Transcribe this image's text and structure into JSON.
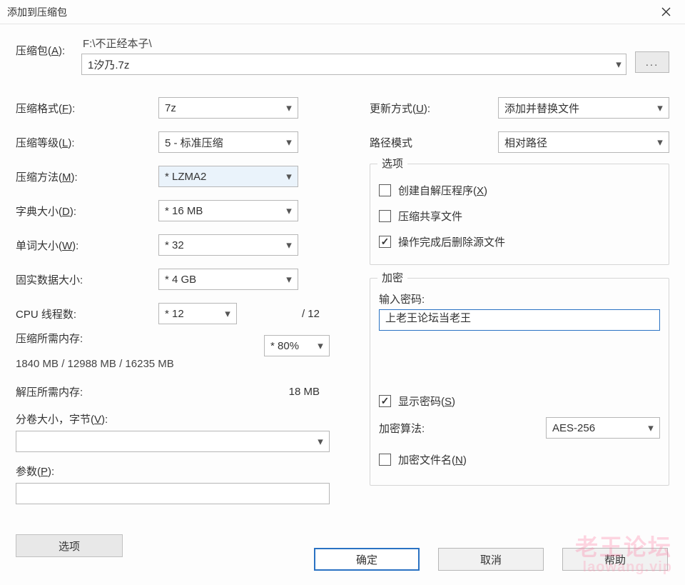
{
  "window": {
    "title": "添加到压缩包"
  },
  "archive": {
    "label_pre": "压缩包(",
    "label_key": "A",
    "label_post": "):",
    "path_text": "F:\\不正经本子\\",
    "filename": "1汐乃.7z"
  },
  "left": {
    "format": {
      "label_pre": "压缩格式(",
      "label_key": "F",
      "label_post": "):",
      "value": "7z"
    },
    "level": {
      "label_pre": "压缩等级(",
      "label_key": "L",
      "label_post": "):",
      "value": "5 - 标准压缩"
    },
    "method": {
      "label_pre": "压缩方法(",
      "label_key": "M",
      "label_post": "):",
      "value": "* LZMA2"
    },
    "dict": {
      "label_pre": "字典大小(",
      "label_key": "D",
      "label_post": "):",
      "value": "* 16 MB"
    },
    "word": {
      "label_pre": "单词大小(",
      "label_key": "W",
      "label_post": "):",
      "value": "* 32"
    },
    "solid": {
      "label": "固实数据大小:",
      "value": "* 4 GB"
    },
    "threads": {
      "label": "CPU 线程数:",
      "value": "* 12",
      "total": "/ 12"
    },
    "mem_comp": {
      "label": "压缩所需内存:",
      "detail": "1840 MB / 12988 MB / 16235 MB",
      "percent": "* 80%"
    },
    "mem_decomp": {
      "label": "解压所需内存:",
      "value": "18 MB"
    },
    "split": {
      "label_pre": "分卷大小，字节(",
      "label_key": "V",
      "label_post": "):"
    },
    "params": {
      "label_pre": "参数(",
      "label_key": "P",
      "label_post": "):"
    },
    "options_btn": "选项"
  },
  "right": {
    "update_mode": {
      "label_pre": "更新方式(",
      "label_key": "U",
      "label_post": "):",
      "value": "添加并替换文件"
    },
    "path_mode": {
      "label": "路径模式",
      "value": "相对路径"
    },
    "options_legend": "选项",
    "opt_sfx": {
      "label_pre": "创建自解压程序(",
      "label_key": "X",
      "label_post": ")",
      "checked": false
    },
    "opt_share": {
      "label": "压缩共享文件",
      "checked": false
    },
    "opt_del": {
      "label": "操作完成后删除源文件",
      "checked": true
    },
    "enc_legend": "加密",
    "pwd_label": "输入密码:",
    "pwd_value": "上老王论坛当老王",
    "show_pwd": {
      "label_pre": "显示密码(",
      "label_key": "S",
      "label_post": ")",
      "checked": true
    },
    "enc_method": {
      "label": "加密算法:",
      "value": "AES-256"
    },
    "enc_names": {
      "label_pre": "加密文件名(",
      "label_key": "N",
      "label_post": ")",
      "checked": false
    }
  },
  "footer": {
    "ok": "确定",
    "cancel": "取消",
    "help": "帮助"
  },
  "watermark": {
    "line1": "老王论坛",
    "line2": "laowang.vip"
  },
  "browse_btn": "..."
}
